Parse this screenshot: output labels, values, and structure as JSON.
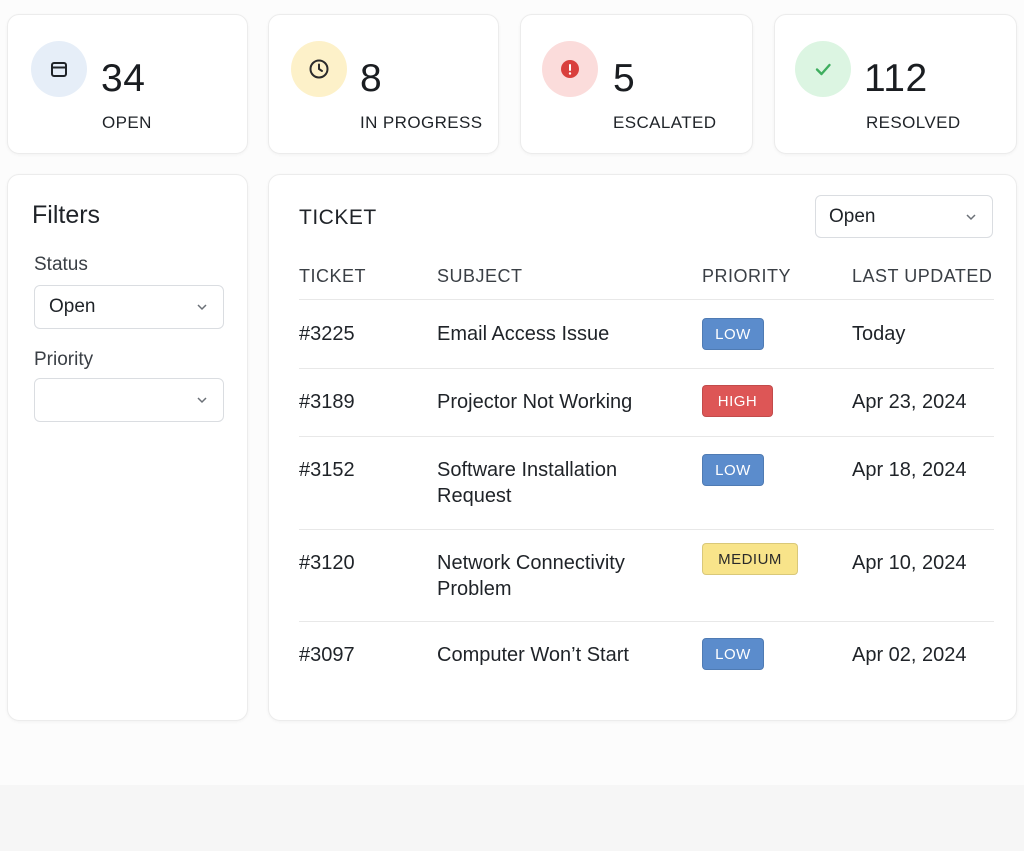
{
  "stats": [
    {
      "value": "34",
      "label": "OPEN",
      "icon": "inbox-icon",
      "color": "#dfe9f7"
    },
    {
      "value": "8",
      "label": "IN PROGRESS",
      "icon": "clock-icon",
      "color": "#fdf1c9"
    },
    {
      "value": "5",
      "label": "ESCALATED",
      "icon": "alert-icon",
      "color": "#fbdcdb"
    },
    {
      "value": "112",
      "label": "RESOLVED",
      "icon": "check-icon",
      "color": "#dcf5e2"
    }
  ],
  "filters": {
    "title": "Filters",
    "status_label": "Status",
    "status_value": "Open",
    "priority_label": "Priority",
    "priority_value": ""
  },
  "table": {
    "title": "TICKET",
    "select_value": "Open",
    "headers": [
      "TICKET",
      "SUBJECT",
      "PRIORITY",
      "LAST UPDATED"
    ],
    "rows": [
      {
        "ticket": "#3225",
        "subject": "Email Access Issue",
        "priority": "LOW",
        "updated": "Today"
      },
      {
        "ticket": "#3189",
        "subject": "Projector Not Working",
        "priority": "HIGH",
        "updated": "Apr 23, 2024"
      },
      {
        "ticket": "#3152",
        "subject": "Software Installation Request",
        "priority": "LOW",
        "updated": "Apr 18, 2024"
      },
      {
        "ticket": "#3120",
        "subject": "Network Connectivity Problem",
        "priority": "MEDIUM",
        "updated": "Apr 10, 2024"
      },
      {
        "ticket": "#3097",
        "subject": "Computer Won’t Start",
        "priority": "LOW",
        "updated": "Apr 02, 2024"
      }
    ]
  },
  "priority_colors": {
    "LOW": "#5b8ccc",
    "HIGH": "#dd5656",
    "MEDIUM": "#f8e48a"
  }
}
